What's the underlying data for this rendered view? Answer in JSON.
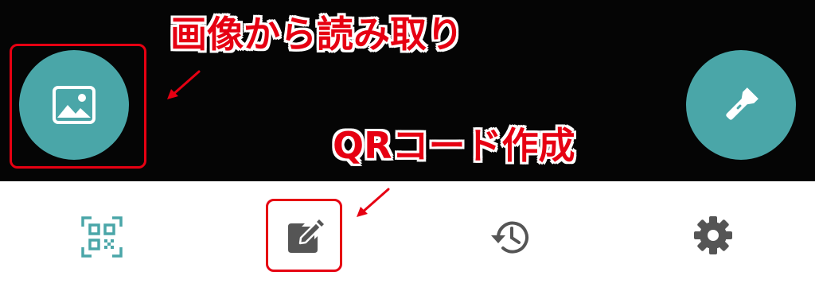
{
  "annotations": {
    "gallery_caption": "画像から読み取り",
    "create_caption": "QRコード作成"
  },
  "colors": {
    "accent": "#4aa6a8",
    "highlight": "#e60012",
    "nav_icon": "#555555",
    "camera_background": "#050505"
  },
  "camera": {
    "gallery_button_icon": "image-icon",
    "flashlight_button_icon": "flashlight-icon"
  },
  "bottom_nav": {
    "items": [
      {
        "icon": "qr-scan-icon",
        "active": true
      },
      {
        "icon": "edit-icon",
        "active": false
      },
      {
        "icon": "history-icon",
        "active": false
      },
      {
        "icon": "gear-icon",
        "active": false
      }
    ]
  }
}
